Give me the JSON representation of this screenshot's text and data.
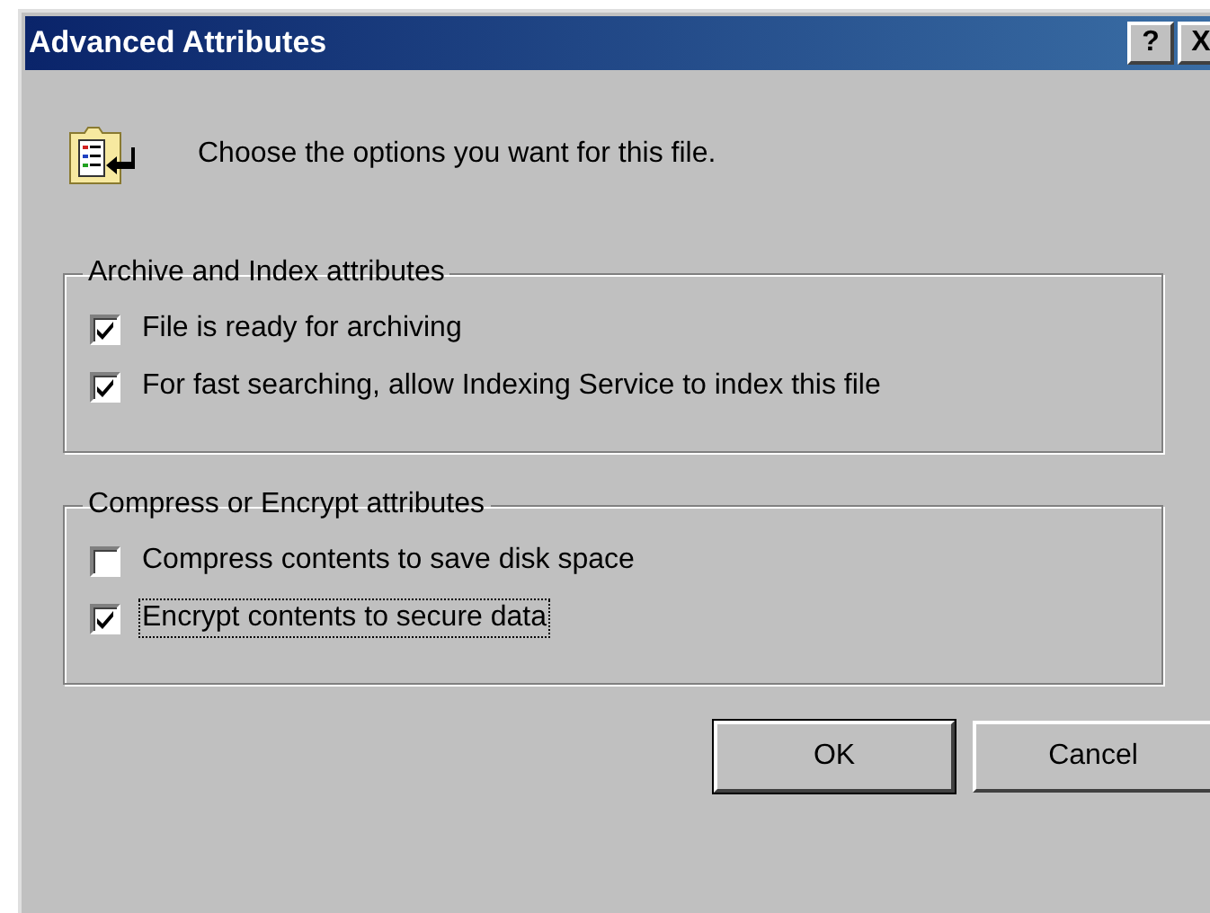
{
  "window": {
    "title": "Advanced Attributes",
    "title_buttons": [
      "?",
      "X"
    ]
  },
  "intro": "Choose the options you want for this file.",
  "groups": [
    {
      "title": "Archive and Index attributes",
      "options": [
        {
          "label": "File is ready for archiving",
          "checked": true,
          "focused": false
        },
        {
          "label": "For fast searching, allow Indexing Service to index this file",
          "checked": true,
          "focused": false
        }
      ]
    },
    {
      "title": "Compress or Encrypt attributes",
      "options": [
        {
          "label": "Compress contents to save disk space",
          "checked": false,
          "focused": false
        },
        {
          "label": "Encrypt contents to secure data",
          "checked": true,
          "focused": true
        }
      ]
    }
  ],
  "buttons": [
    {
      "label": "OK",
      "default": true
    },
    {
      "label": "Cancel",
      "default": false
    }
  ]
}
